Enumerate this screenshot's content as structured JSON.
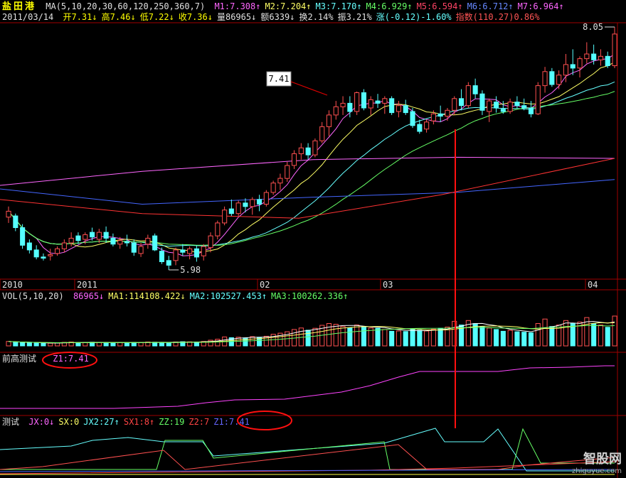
{
  "header": {
    "stock_name": "盐田港",
    "ma_params": "MA(5,10,20,30,60,120,250,360,7)",
    "ma_values": [
      {
        "label": "M1:7.308↑",
        "color": "#ff66ff"
      },
      {
        "label": "M2:7.204↑",
        "color": "#ffff66"
      },
      {
        "label": "M3:7.170↑",
        "color": "#66ffff"
      },
      {
        "label": "M4:6.929↑",
        "color": "#66ff66"
      },
      {
        "label": "M5:6.594↑",
        "color": "#ff4466"
      },
      {
        "label": "M6:6.712↑",
        "color": "#6688ff"
      },
      {
        "label": "M7:6.964↑",
        "color": "#ff66ff"
      }
    ],
    "date": "2011/03/14",
    "quote": [
      {
        "label": "开7.31↓",
        "color": "#ffff00"
      },
      {
        "label": "高7.46↓",
        "color": "#ffff00"
      },
      {
        "label": "低7.22↓",
        "color": "#ffff00"
      },
      {
        "label": "收7.36↓",
        "color": "#ffff00"
      },
      {
        "label": "量86965↓",
        "color": "#e0e0e0"
      },
      {
        "label": "额6339↓",
        "color": "#e0e0e0"
      },
      {
        "label": "换2.14%",
        "color": "#e0e0e0"
      },
      {
        "label": "振3.21%",
        "color": "#e0e0e0"
      },
      {
        "label": "涨(-0.12)-1.60%",
        "color": "#66ffff"
      },
      {
        "label": "指数(110.27)0.86%",
        "color": "#ff5555"
      }
    ]
  },
  "price_pane": {
    "high_label": "8.05",
    "low_label": "5.98",
    "callout_label": "7.41",
    "x_labels": [
      "2010",
      "2011",
      "02",
      "03",
      "04"
    ]
  },
  "vol_pane": {
    "title": "VOL(5,10,20)",
    "items": [
      {
        "label": "86965↓",
        "color": "#ff66ff"
      },
      {
        "label": "MA1:114108.422↓",
        "color": "#ffff66"
      },
      {
        "label": "MA2:102527.453↑",
        "color": "#66ffff"
      },
      {
        "label": "MA3:100262.336↑",
        "color": "#66ff66"
      }
    ]
  },
  "qg_pane": {
    "title": "前高测试",
    "value": "Z1:7.41",
    "value_color": "#ff66ff"
  },
  "test_pane": {
    "title": "测试",
    "items": [
      {
        "label": "JX:0↓",
        "color": "#ff66ff"
      },
      {
        "label": "SX:0",
        "color": "#ffff66"
      },
      {
        "label": "JX2:27↑",
        "color": "#66ffff"
      },
      {
        "label": "SX1:8↑",
        "color": "#ff4444"
      },
      {
        "label": "ZZ:19",
        "color": "#66ff66"
      },
      {
        "label": "Z2:7",
        "color": "#ff4444"
      },
      {
        "label": "Z1:7.41",
        "color": "#6666ff"
      }
    ]
  },
  "watermark": {
    "title": "智股网",
    "url": "zhiguyue.com"
  },
  "colors": {
    "up": "#ff5050",
    "down": "#55ffff",
    "grid": "#a00000",
    "annotation": "#dd0000"
  },
  "chart_data": {
    "type": "candlestick",
    "x_labels": [
      "2010",
      "2011",
      "02",
      "03",
      "04"
    ],
    "price_range": [
      5.98,
      8.05
    ],
    "candles": [
      [
        6.43,
        6.52,
        6.38,
        6.48
      ],
      [
        6.44,
        6.46,
        6.31,
        6.34
      ],
      [
        6.34,
        6.37,
        6.16,
        6.19
      ],
      [
        6.21,
        6.24,
        6.12,
        6.15
      ],
      [
        6.15,
        6.19,
        6.07,
        6.09
      ],
      [
        6.09,
        6.12,
        6.06,
        6.08
      ],
      [
        6.1,
        6.16,
        6.06,
        6.11
      ],
      [
        6.12,
        6.18,
        6.1,
        6.16
      ],
      [
        6.16,
        6.24,
        6.13,
        6.21
      ],
      [
        6.21,
        6.3,
        6.18,
        6.25
      ],
      [
        6.27,
        6.3,
        6.2,
        6.23
      ],
      [
        6.24,
        6.3,
        6.2,
        6.28
      ],
      [
        6.3,
        6.34,
        6.23,
        6.26
      ],
      [
        6.24,
        6.33,
        6.21,
        6.3
      ],
      [
        6.3,
        6.35,
        6.21,
        6.25
      ],
      [
        6.25,
        6.29,
        6.18,
        6.2
      ],
      [
        6.2,
        6.26,
        6.16,
        6.23
      ],
      [
        6.22,
        6.28,
        6.18,
        6.21
      ],
      [
        6.21,
        6.24,
        6.1,
        6.13
      ],
      [
        6.12,
        6.21,
        6.09,
        6.18
      ],
      [
        6.2,
        6.28,
        6.16,
        6.25
      ],
      [
        6.27,
        6.29,
        6.14,
        6.15
      ],
      [
        6.14,
        6.17,
        6.03,
        6.05
      ],
      [
        6.06,
        6.1,
        5.98,
        6.02
      ],
      [
        6.06,
        6.17,
        6.02,
        6.15
      ],
      [
        6.15,
        6.2,
        6.1,
        6.13
      ],
      [
        6.12,
        6.18,
        6.07,
        6.16
      ],
      [
        6.16,
        6.19,
        6.05,
        6.09
      ],
      [
        6.1,
        6.2,
        6.06,
        6.18
      ],
      [
        6.17,
        6.3,
        6.13,
        6.27
      ],
      [
        6.27,
        6.4,
        6.24,
        6.38
      ],
      [
        6.38,
        6.52,
        6.36,
        6.49
      ],
      [
        6.5,
        6.58,
        6.44,
        6.46
      ],
      [
        6.46,
        6.57,
        6.44,
        6.55
      ],
      [
        6.55,
        6.59,
        6.47,
        6.52
      ],
      [
        6.52,
        6.6,
        6.45,
        6.58
      ],
      [
        6.58,
        6.62,
        6.48,
        6.54
      ],
      [
        6.54,
        6.66,
        6.52,
        6.64
      ],
      [
        6.64,
        6.74,
        6.62,
        6.72
      ],
      [
        6.72,
        6.8,
        6.66,
        6.76
      ],
      [
        6.76,
        6.9,
        6.73,
        6.87
      ],
      [
        6.87,
        7.0,
        6.84,
        6.97
      ],
      [
        6.97,
        7.06,
        6.92,
        7.02
      ],
      [
        7.02,
        7.06,
        6.92,
        6.96
      ],
      [
        6.96,
        7.1,
        6.94,
        7.08
      ],
      [
        7.08,
        7.24,
        7.06,
        7.2
      ],
      [
        7.2,
        7.34,
        7.12,
        7.3
      ],
      [
        7.3,
        7.42,
        7.26,
        7.37
      ],
      [
        7.37,
        7.46,
        7.3,
        7.4
      ],
      [
        7.4,
        7.46,
        7.28,
        7.33
      ],
      [
        7.33,
        7.5,
        7.3,
        7.49
      ],
      [
        7.49,
        7.52,
        7.34,
        7.36
      ],
      [
        7.36,
        7.46,
        7.3,
        7.43
      ],
      [
        7.42,
        7.48,
        7.36,
        7.4
      ],
      [
        7.4,
        7.46,
        7.31,
        7.44
      ],
      [
        7.44,
        7.46,
        7.3,
        7.32
      ],
      [
        7.33,
        7.42,
        7.28,
        7.38
      ],
      [
        7.38,
        7.43,
        7.3,
        7.32
      ],
      [
        7.33,
        7.36,
        7.19,
        7.21
      ],
      [
        7.22,
        7.26,
        7.14,
        7.16
      ],
      [
        7.18,
        7.26,
        7.15,
        7.24
      ],
      [
        7.25,
        7.34,
        7.22,
        7.31
      ],
      [
        7.31,
        7.38,
        7.24,
        7.29
      ],
      [
        7.29,
        7.36,
        7.25,
        7.34
      ],
      [
        7.34,
        7.46,
        7.3,
        7.44
      ],
      [
        7.44,
        7.52,
        7.34,
        7.38
      ],
      [
        7.38,
        7.58,
        7.36,
        7.55
      ],
      [
        7.55,
        7.61,
        7.44,
        7.48
      ],
      [
        7.48,
        7.51,
        7.3,
        7.34
      ],
      [
        7.33,
        7.44,
        7.24,
        7.42
      ],
      [
        7.41,
        7.46,
        7.32,
        7.36
      ],
      [
        7.35,
        7.42,
        7.31,
        7.33
      ],
      [
        7.33,
        7.44,
        7.31,
        7.41
      ],
      [
        7.41,
        7.46,
        7.36,
        7.38
      ],
      [
        7.38,
        7.44,
        7.34,
        7.36
      ],
      [
        7.36,
        7.42,
        7.28,
        7.31
      ],
      [
        7.31,
        7.58,
        7.3,
        7.55
      ],
      [
        7.55,
        7.71,
        7.49,
        7.67
      ],
      [
        7.67,
        7.7,
        7.54,
        7.56
      ],
      [
        7.56,
        7.68,
        7.52,
        7.64
      ],
      [
        7.64,
        7.82,
        7.58,
        7.73
      ],
      [
        7.73,
        7.86,
        7.64,
        7.7
      ],
      [
        7.7,
        7.8,
        7.62,
        7.78
      ],
      [
        7.78,
        7.92,
        7.74,
        7.82
      ],
      [
        7.82,
        7.9,
        7.73,
        7.77
      ],
      [
        7.77,
        7.86,
        7.72,
        7.8
      ],
      [
        7.8,
        7.84,
        7.7,
        7.72
      ],
      [
        7.72,
        8.05,
        7.7,
        7.99
      ]
    ],
    "vol_range": [
      0,
      300000
    ],
    "volumes": [
      30000,
      25000,
      22000,
      20000,
      19000,
      18000,
      18000,
      21000,
      24000,
      26000,
      22000,
      23000,
      25000,
      24000,
      23000,
      20000,
      22000,
      21000,
      24000,
      23000,
      26000,
      25000,
      24000,
      22000,
      26000,
      28000,
      27000,
      26000,
      30000,
      38000,
      45000,
      60000,
      55000,
      58000,
      54000,
      62000,
      58000,
      65000,
      78000,
      85000,
      95000,
      110000,
      120000,
      105000,
      118000,
      138000,
      150000,
      145000,
      130000,
      120000,
      140000,
      125000,
      120000,
      118000,
      110000,
      98000,
      100000,
      96000,
      110000,
      105000,
      100000,
      112000,
      118000,
      126000,
      165000,
      140000,
      170000,
      150000,
      128000,
      120000,
      110000,
      98000,
      104000,
      95000,
      92000,
      88000,
      150000,
      180000,
      130000,
      140000,
      170000,
      150000,
      160000,
      190000,
      150000,
      140000,
      125000,
      200000
    ]
  }
}
